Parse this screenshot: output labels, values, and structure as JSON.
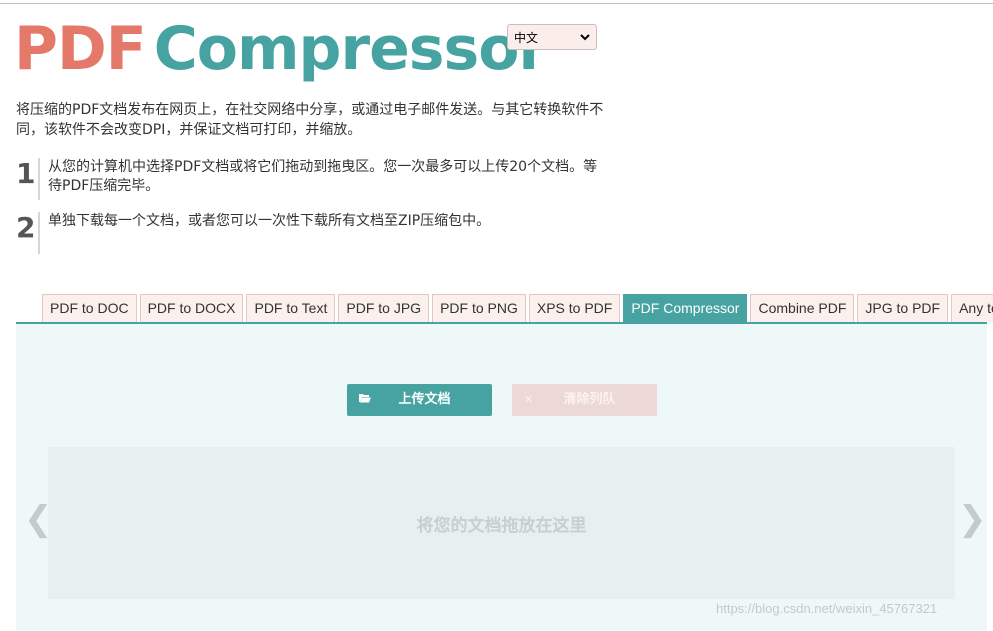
{
  "logo": {
    "part1": "PDF",
    "part2": "Compressor"
  },
  "language": {
    "selected": "中文"
  },
  "intro": "将压缩的PDF文档发布在网页上，在社交网络中分享，或通过电子邮件发送。与其它转换软件不同，该软件不会改变DPI，并保证文档可打印，并缩放。",
  "steps": [
    {
      "num": "1",
      "text": "从您的计算机中选择PDF文档或将它们拖动到拖曳区。您一次最多可以上传20个文档。等待PDF压缩完毕。"
    },
    {
      "num": "2",
      "text": "单独下载每一个文档，或者您可以一次性下载所有文档至ZIP压缩包中。"
    }
  ],
  "tabs": [
    {
      "label": "PDF to DOC"
    },
    {
      "label": "PDF to DOCX"
    },
    {
      "label": "PDF to Text"
    },
    {
      "label": "PDF to JPG"
    },
    {
      "label": "PDF to PNG"
    },
    {
      "label": "XPS to PDF"
    },
    {
      "label": "PDF Compressor",
      "active": true
    },
    {
      "label": "Combine PDF"
    },
    {
      "label": "JPG to PDF"
    },
    {
      "label": "Any to PDF"
    }
  ],
  "buttons": {
    "upload": "上传文档",
    "clear": "清除列队"
  },
  "dropzone": {
    "message": "将您的文档拖放在这里"
  },
  "arrows": {
    "left": "❮",
    "right": "❯"
  },
  "watermark": "https://blog.csdn.net/weixin_45767321",
  "colors": {
    "accent": "#47a3a1",
    "brand_red": "#e4796a",
    "tab_bg": "#fcf0ec",
    "panel_bg": "#eef8f8"
  },
  "icons": {
    "upload": "folder-open-icon",
    "clear": "close-icon",
    "lang": "chevron-down-icon"
  }
}
